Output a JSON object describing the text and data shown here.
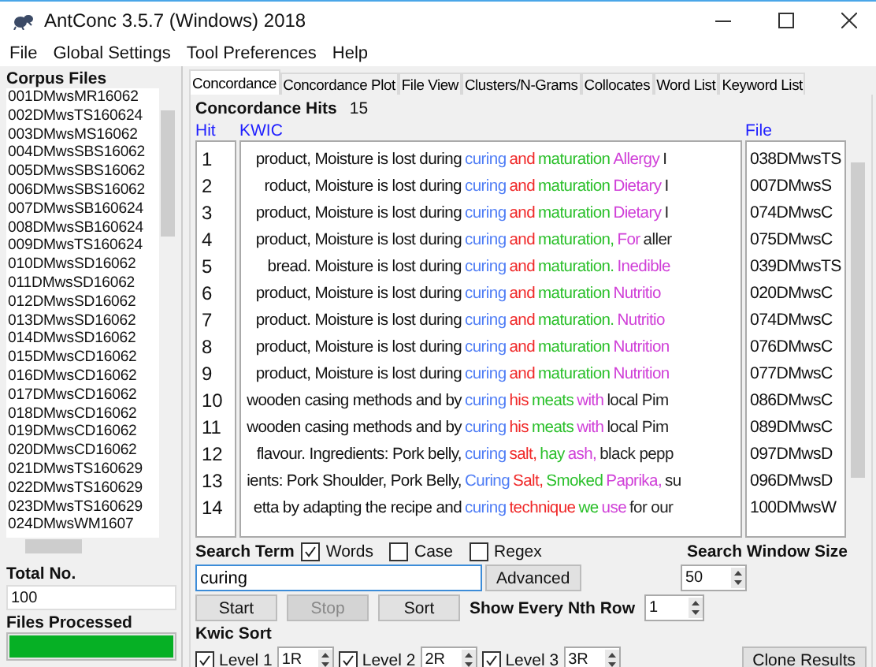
{
  "window": {
    "title": "AntConc 3.5.7 (Windows) 2018"
  },
  "menu": [
    "File",
    "Global Settings",
    "Tool Preferences",
    "Help"
  ],
  "corpus_files": {
    "label": "Corpus Files",
    "files": [
      "001DMwsMR16062",
      "002DMwsTS160624",
      "003DMwsMS16062",
      "004DMwsSBS16062",
      "005DMwsSBS16062",
      "006DMwsSBS16062",
      "007DMwsSB160624",
      "008DMwsSB160624",
      "009DMwsTS160624",
      "010DMwsSD16062",
      "011DMwsSD16062",
      "012DMwsSD16062",
      "013DMwsSD16062",
      "014DMwsSD16062",
      "015DMwsCD16062",
      "016DMwsCD16062",
      "017DMwsCD16062",
      "018DMwsCD16062",
      "019DMwsCD16062",
      "020DMwsCD16062",
      "021DMwsTS160629",
      "022DMwsTS160629",
      "023DMwsTS160629",
      "024DMwsWM1607"
    ]
  },
  "total": {
    "label": "Total No.",
    "value": "100"
  },
  "progress": {
    "label": "Files Processed",
    "level": 1
  },
  "tabs": [
    {
      "label": "Concordance",
      "selected": true
    },
    {
      "label": "Concordance Plot",
      "selected": false
    },
    {
      "label": "File View",
      "selected": false
    },
    {
      "label": "Clusters/N-Grams",
      "selected": false
    },
    {
      "label": "Collocates",
      "selected": false
    },
    {
      "label": "Word List",
      "selected": false
    },
    {
      "label": "Keyword List",
      "selected": false
    }
  ],
  "hits": {
    "label": "Concordance Hits",
    "value": "15"
  },
  "table": {
    "columns": [
      "Hit",
      "KWIC",
      "File"
    ],
    "rows": [
      {
        "hit": "1",
        "left": "product, Moisture is lost during",
        "right": [
          {
            "text": "curing",
            "color": "#4f7df5"
          },
          {
            "text": "and",
            "color": "#f02828"
          },
          {
            "text": "maturation",
            "color": "#2cc02c"
          },
          {
            "text": "Allergy",
            "color": "#d040d8"
          },
          {
            "text": "I",
            "color": "#222222"
          }
        ],
        "file": "038DMwsTS"
      },
      {
        "hit": "2",
        "left": "roduct,  Moisture is lost during",
        "right": [
          {
            "text": "curing",
            "color": "#4f7df5"
          },
          {
            "text": "and",
            "color": "#f02828"
          },
          {
            "text": "maturation",
            "color": "#2cc02c"
          },
          {
            "text": "Dietary",
            "color": "#d040d8"
          },
          {
            "text": "I",
            "color": "#222222"
          }
        ],
        "file": "007DMwsS"
      },
      {
        "hit": "3",
        "left": "product, Moisture is lost during",
        "right": [
          {
            "text": "curing",
            "color": "#4f7df5"
          },
          {
            "text": "and",
            "color": "#f02828"
          },
          {
            "text": "maturation",
            "color": "#2cc02c"
          },
          {
            "text": "Dietary",
            "color": "#d040d8"
          },
          {
            "text": "I",
            "color": "#222222"
          }
        ],
        "file": "074DMwsC"
      },
      {
        "hit": "4",
        "left": "product, Moisture is lost during",
        "right": [
          {
            "text": "curing",
            "color": "#4f7df5"
          },
          {
            "text": "and",
            "color": "#f02828"
          },
          {
            "text": "maturation,",
            "color": "#2cc02c"
          },
          {
            "text": "For",
            "color": "#d040d8"
          },
          {
            "text": "aller",
            "color": "#222222"
          }
        ],
        "file": "075DMwsC"
      },
      {
        "hit": "5",
        "left": "bread.  Moisture is lost during",
        "right": [
          {
            "text": "curing",
            "color": "#4f7df5"
          },
          {
            "text": "and",
            "color": "#f02828"
          },
          {
            "text": "maturation.",
            "color": "#2cc02c"
          },
          {
            "text": "Inedible",
            "color": "#d040d8"
          }
        ],
        "file": "039DMwsTS"
      },
      {
        "hit": "6",
        "left": "product, Moisture is lost during",
        "right": [
          {
            "text": "curing",
            "color": "#4f7df5"
          },
          {
            "text": "and",
            "color": "#f02828"
          },
          {
            "text": "maturation",
            "color": "#2cc02c"
          },
          {
            "text": "Nutritio",
            "color": "#d040d8"
          }
        ],
        "file": "020DMwsC"
      },
      {
        "hit": "7",
        "left": "product. Moisture is lost during",
        "right": [
          {
            "text": "curing",
            "color": "#4f7df5"
          },
          {
            "text": "and",
            "color": "#f02828"
          },
          {
            "text": "maturation.",
            "color": "#2cc02c"
          },
          {
            "text": "Nutritio",
            "color": "#d040d8"
          }
        ],
        "file": "074DMwsC"
      },
      {
        "hit": "8",
        "left": "product, Moisture is lost during",
        "right": [
          {
            "text": "curing",
            "color": "#4f7df5"
          },
          {
            "text": "and",
            "color": "#f02828"
          },
          {
            "text": "maturation",
            "color": "#2cc02c"
          },
          {
            "text": "Nutrition",
            "color": "#d040d8"
          }
        ],
        "file": "076DMwsC"
      },
      {
        "hit": "9",
        "left": "product, Moisture is lost during",
        "right": [
          {
            "text": "curing",
            "color": "#4f7df5"
          },
          {
            "text": "and",
            "color": "#f02828"
          },
          {
            "text": "maturation",
            "color": "#2cc02c"
          },
          {
            "text": "Nutrition",
            "color": "#d040d8"
          }
        ],
        "file": "077DMwsC"
      },
      {
        "hit": "10",
        "left": "wooden casing methods and by",
        "right": [
          {
            "text": "curing",
            "color": "#4f7df5"
          },
          {
            "text": "his",
            "color": "#f02828"
          },
          {
            "text": "meats",
            "color": "#2cc02c"
          },
          {
            "text": "with",
            "color": "#d040d8"
          },
          {
            "text": "local Pim",
            "color": "#222222"
          }
        ],
        "file": "086DMwsC"
      },
      {
        "hit": "11",
        "left": "wooden casing methods and by",
        "right": [
          {
            "text": "curing",
            "color": "#4f7df5"
          },
          {
            "text": "his",
            "color": "#f02828"
          },
          {
            "text": "meats",
            "color": "#2cc02c"
          },
          {
            "text": "with",
            "color": "#d040d8"
          },
          {
            "text": "local Pim",
            "color": "#222222"
          }
        ],
        "file": "089DMwsC"
      },
      {
        "hit": "12",
        "left": "flavour. Ingredients: Pork belly,",
        "right": [
          {
            "text": "curing",
            "color": "#4f7df5"
          },
          {
            "text": "salt,",
            "color": "#f02828"
          },
          {
            "text": "hay",
            "color": "#2cc02c"
          },
          {
            "text": "ash,",
            "color": "#d040d8"
          },
          {
            "text": "black pepp",
            "color": "#222222"
          }
        ],
        "file": "097DMwsD"
      },
      {
        "hit": "13",
        "left": "ients: Pork Shoulder, Pork Belly,",
        "right": [
          {
            "text": "Curing",
            "color": "#4f7df5"
          },
          {
            "text": "Salt,",
            "color": "#f02828"
          },
          {
            "text": "Smoked",
            "color": "#2cc02c"
          },
          {
            "text": "Paprika,",
            "color": "#d040d8"
          },
          {
            "text": "su",
            "color": "#222222"
          }
        ],
        "file": "096DMwsD"
      },
      {
        "hit": "14",
        "left": "etta by adapting the recipe and",
        "right": [
          {
            "text": "curing",
            "color": "#4f7df5"
          },
          {
            "text": "technique",
            "color": "#f02828"
          },
          {
            "text": "we",
            "color": "#2cc02c"
          },
          {
            "text": "use",
            "color": "#d040d8"
          },
          {
            "text": "for our",
            "color": "#222222"
          }
        ],
        "file": "100DMwsW"
      }
    ]
  },
  "search": {
    "label": "Search Term",
    "options": [
      {
        "label": "Words",
        "checked": true
      },
      {
        "label": "Case",
        "checked": false
      },
      {
        "label": "Regex",
        "checked": false
      }
    ],
    "value": "curing",
    "advanced": "Advanced"
  },
  "buttons": [
    {
      "label": "Start",
      "disabled": false
    },
    {
      "label": "Stop",
      "disabled": true
    },
    {
      "label": "Sort",
      "disabled": false
    }
  ],
  "nth_row": {
    "label": "Show Every Nth Row",
    "value": "1"
  },
  "window_size": {
    "label": "Search Window Size",
    "value": "50"
  },
  "kwic_sort": {
    "label": "Kwic Sort",
    "levels": [
      {
        "label": "Level 1",
        "checked": true,
        "value": "1R"
      },
      {
        "label": "Level 2",
        "checked": true,
        "value": "2R"
      },
      {
        "label": "Level 3",
        "checked": true,
        "value": "3R"
      }
    ]
  },
  "clone": "Clone Results"
}
